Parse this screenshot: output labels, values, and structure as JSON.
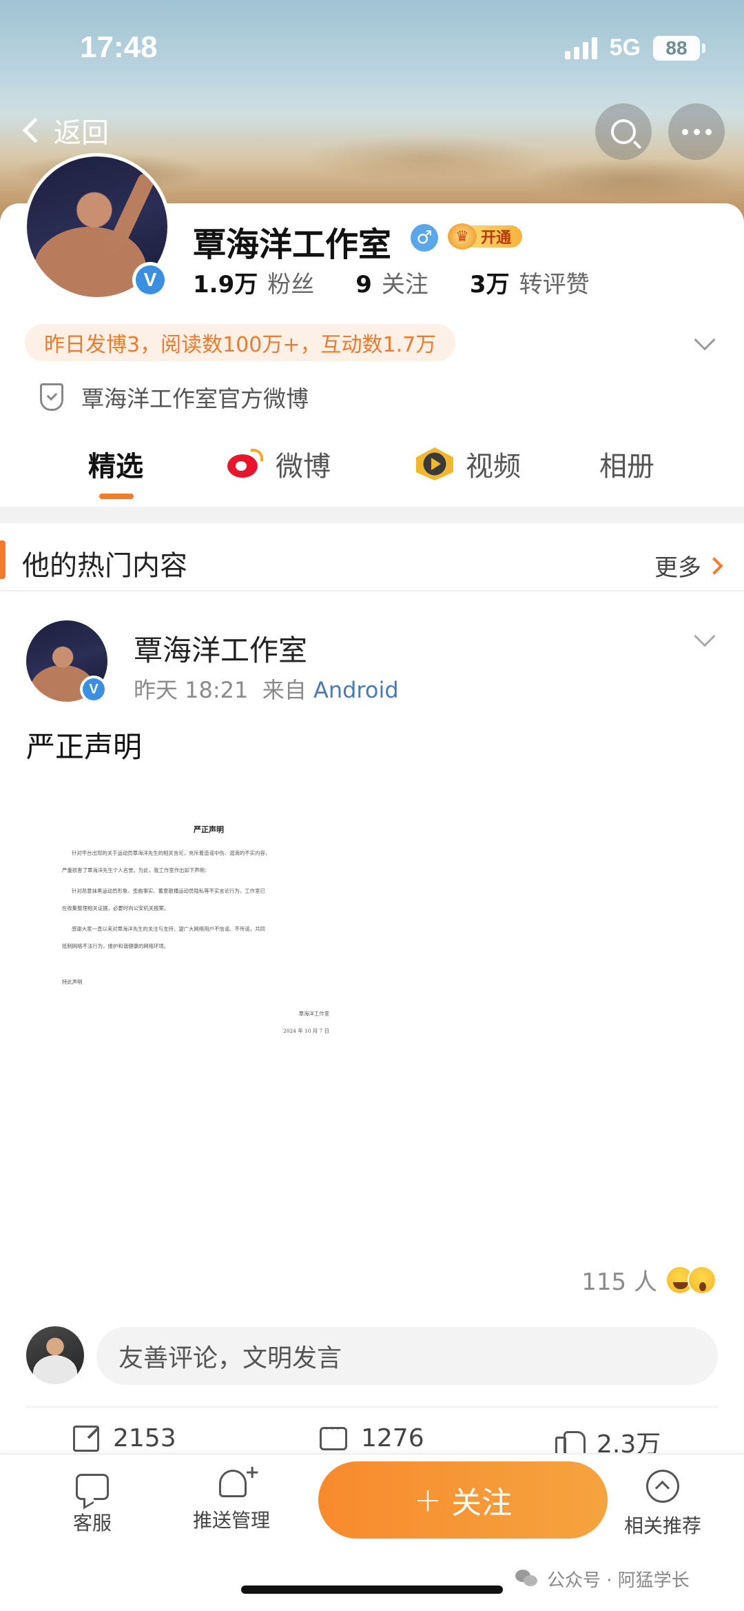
{
  "status_bar": {
    "time": "17:48",
    "network": "5G",
    "battery": "88"
  },
  "nav": {
    "back_label": "返回"
  },
  "profile": {
    "name": "覃海洋工作室",
    "gender_symbol": "♂",
    "vip_label": "开通",
    "verified_mark": "V",
    "stats": [
      {
        "value": "1.9万",
        "label": "粉丝"
      },
      {
        "value": "9",
        "label": "关注"
      },
      {
        "value": "3万",
        "label": "转评赞"
      }
    ],
    "activity": "昨日发博3，阅读数100万+，互动数1.7万",
    "verification": "覃海洋工作室官方微博"
  },
  "tabs": [
    {
      "label": "精选",
      "active": true
    },
    {
      "label": "微博",
      "active": false
    },
    {
      "label": "视频",
      "active": false
    },
    {
      "label": "相册",
      "active": false
    }
  ],
  "section": {
    "title": "他的热门内容",
    "more_label": "更多"
  },
  "post": {
    "author": "覃海洋工作室",
    "time": "昨天 18:21",
    "from_label": "来自",
    "source": "Android",
    "text": "严正声明",
    "document": {
      "title": "严正声明",
      "paragraphs": [
        "针对平台出现的关于运动员覃海洋先生的相关言论，充斥着造谣中伤、混淆的不实内容，",
        "严重损害了覃海洋先生个人名誉。为此，我工作室作出如下声明：",
        "针对恶意抹黑运动员形象、歪曲事实、蓄意散播运动员隐私等不实言论行为，工作室已",
        "在收集整理相关证据，必要时向公安机关报案。",
        "感谢大家一直以来对覃海洋先生的关注与支持，望广大网络用户不信谣、不传谣，共同",
        "抵制网络不法行为，维护和谐健康的网络环境。",
        "特此声明"
      ],
      "signature": "覃海洋工作室",
      "date": "2024 年 10 月 7 日"
    },
    "reactions_count": "115 人",
    "comment_placeholder": "友善评论，文明发言",
    "shares": "2153",
    "comments": "1276",
    "likes": "2.3万"
  },
  "bottom_bar": {
    "service_label": "客服",
    "push_label": "推送管理",
    "follow_plus": "+",
    "follow_label": "关注",
    "recommend_label": "相关推荐"
  },
  "watermark": "公众号 · 阿猛学长",
  "colors": {
    "accent": "#f47b2a",
    "verified_blue": "#3b8fe0",
    "link_blue": "#4a79b8",
    "weibo_red": "#e6162d"
  }
}
